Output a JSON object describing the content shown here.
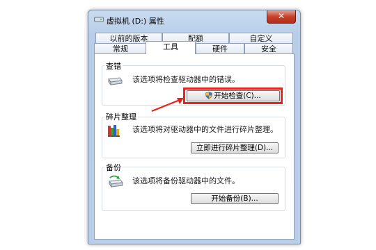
{
  "window": {
    "title": "虚拟机 (D:) 属性",
    "close_glyph": "✕"
  },
  "tabs": {
    "row1": [
      "以前的版本",
      "配额",
      "自定义"
    ],
    "row2": [
      "常规",
      "工具",
      "硬件",
      "安全"
    ],
    "active": "工具"
  },
  "sections": {
    "error_check": {
      "title": "查错",
      "description": "该选项将检查驱动器中的错误。",
      "button_label": "开始检查(C)..."
    },
    "defrag": {
      "title": "碎片整理",
      "description": "该选项将对驱动器中的文件进行碎片整理。",
      "button_label": "立即进行碎片整理(D)..."
    },
    "backup": {
      "title": "备份",
      "description": "该选项将备份驱动器中的文件。",
      "button_label": "开始备份(B)..."
    }
  },
  "annotation": {
    "highlight_color": "#e8221c"
  },
  "icons": {
    "title": "drive-icon",
    "error_check": "hard-drive-icon",
    "defrag": "defrag-icon",
    "backup": "backup-icon",
    "uac": "uac-shield-icon"
  }
}
